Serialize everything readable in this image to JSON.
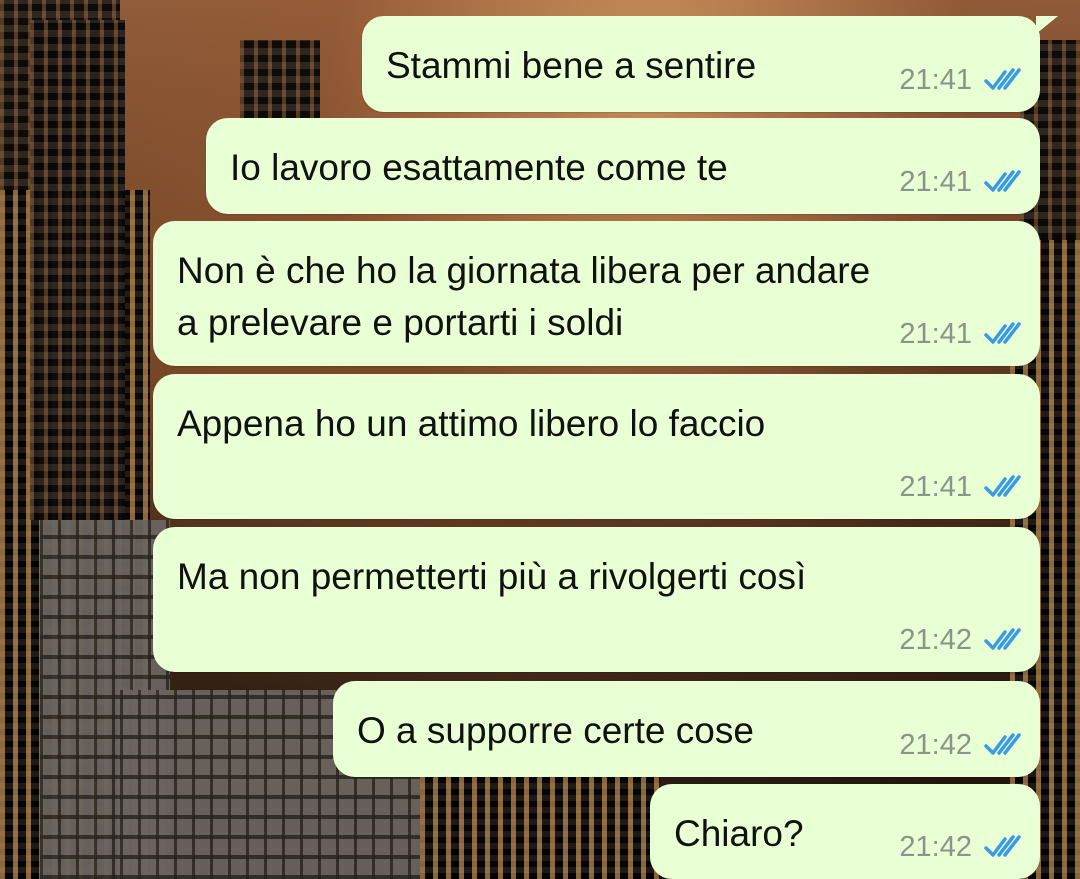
{
  "conversation": {
    "messages": [
      {
        "text": "Stammi bene a sentire",
        "time": "21:41",
        "status": "read"
      },
      {
        "text": "Io lavoro esattamente come te",
        "time": "21:41",
        "status": "read"
      },
      {
        "text": "Non è che ho la giornata libera per andare\na prelevare e portarti i soldi",
        "time": "21:41",
        "status": "read"
      },
      {
        "text": "Appena ho un attimo libero lo faccio",
        "time": "21:41",
        "status": "read"
      },
      {
        "text": "Ma non permetterti più a rivolgerti così",
        "time": "21:42",
        "status": "read"
      },
      {
        "text": "O a supporre certe cose",
        "time": "21:42",
        "status": "read"
      },
      {
        "text": "Chiaro?",
        "time": "21:42",
        "status": "read"
      }
    ]
  },
  "colors": {
    "outgoing_bubble": "#e9ffd4",
    "read_ticks": "#3a9ae8",
    "timestamp": "#8a948a"
  },
  "icons": {
    "status_read": "double-check-icon"
  }
}
